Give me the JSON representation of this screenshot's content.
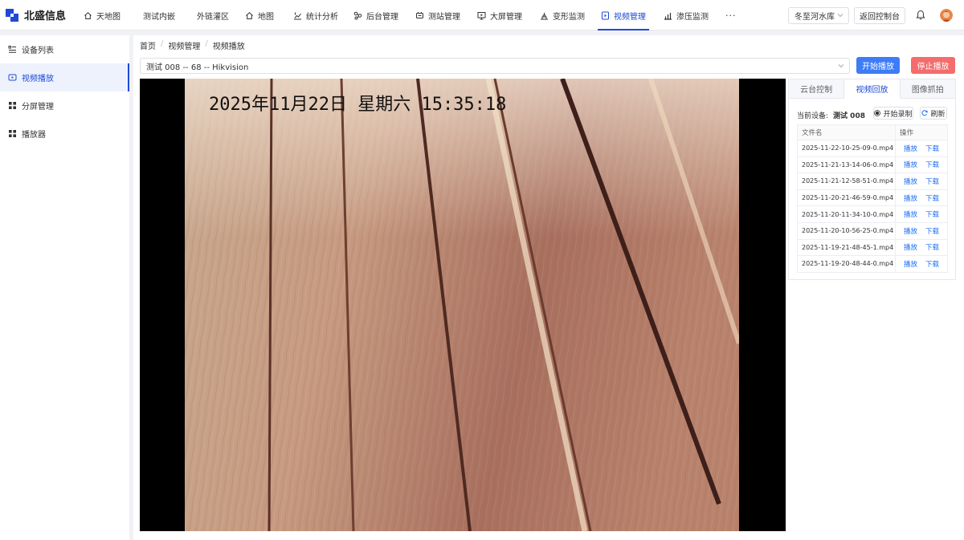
{
  "brand": {
    "name": "北盛信息",
    "color": "#1f49d6"
  },
  "nav": {
    "items": [
      {
        "label": "天地图",
        "icon": "home-icon"
      },
      {
        "label": "测试内嵌",
        "icon": ""
      },
      {
        "label": "外链灌区",
        "icon": ""
      },
      {
        "label": "地图",
        "icon": "home-icon"
      },
      {
        "label": "统计分析",
        "icon": "chart-icon"
      },
      {
        "label": "后台管理",
        "icon": "nodes-icon"
      },
      {
        "label": "测站管理",
        "icon": "station-icon"
      },
      {
        "label": "大屏管理",
        "icon": "monitor-icon"
      },
      {
        "label": "变形监测",
        "icon": "deform-icon"
      },
      {
        "label": "视频管理",
        "icon": "video-icon",
        "active": true
      },
      {
        "label": "渗压监测",
        "icon": "pressure-icon"
      }
    ],
    "more": "···"
  },
  "top_right": {
    "reservoir": "冬至河水库",
    "back": "返回控制台"
  },
  "sidebar": {
    "items": [
      {
        "label": "设备列表",
        "icon": "list-icon"
      },
      {
        "label": "视频播放",
        "icon": "play-video-icon",
        "active": true
      },
      {
        "label": "分屏管理",
        "icon": "grid-icon"
      },
      {
        "label": "播放器",
        "icon": "grid-icon"
      }
    ]
  },
  "breadcrumb": [
    "首页",
    "视频管理",
    "视频播放"
  ],
  "device_select": {
    "value": "测试 008 -- 68 -- Hikvision"
  },
  "actions": {
    "start": "开始播放",
    "stop": "停止播放"
  },
  "video": {
    "osd": "2025年11月22日 星期六 15:35:18"
  },
  "panel": {
    "tabs": [
      "云台控制",
      "视频回放",
      "图像抓拍"
    ],
    "active_tab": 1,
    "current_device_label": "当前设备:",
    "current_device": "测试 008",
    "record_btn": "开始录制",
    "refresh_btn": "刷新",
    "table": {
      "headers": [
        "文件名",
        "操作"
      ],
      "op_play": "播放",
      "op_download": "下载",
      "rows": [
        "2025-11-22-10-25-09-0.mp4",
        "2025-11-21-13-14-06-0.mp4",
        "2025-11-21-12-58-51-0.mp4",
        "2025-11-20-21-46-59-0.mp4",
        "2025-11-20-11-34-10-0.mp4",
        "2025-11-20-10-56-25-0.mp4",
        "2025-11-19-21-48-45-1.mp4",
        "2025-11-19-20-48-44-0.mp4"
      ]
    }
  }
}
